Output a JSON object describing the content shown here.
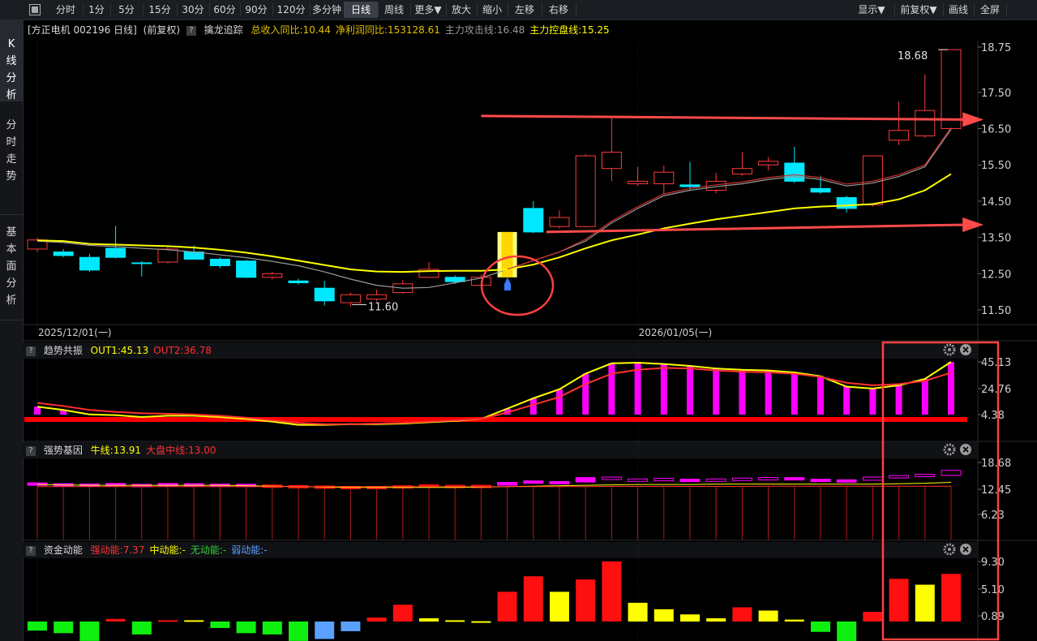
{
  "toolbar": {
    "items": [
      "分时",
      "1分",
      "5分",
      "15分",
      "30分",
      "60分",
      "90分",
      "120分",
      "多分钟",
      "日线",
      "周线",
      "更多▼",
      "放大",
      "缩小",
      "左移",
      "右移"
    ],
    "active_index": 9,
    "right_items": [
      "显示▼",
      "前复权▼",
      "画线",
      "全屏"
    ]
  },
  "sidebar": {
    "items": [
      {
        "label": "K线分析",
        "lines": [
          "K",
          "线",
          "分",
          "析"
        ],
        "active": true
      },
      {
        "label": "分时走势",
        "lines": [
          "分",
          "时",
          "走",
          "势"
        ],
        "active": false
      },
      {
        "label": "基本面分析",
        "lines": [
          "基",
          "本",
          "面",
          "分",
          "析"
        ],
        "active": false
      }
    ]
  },
  "stock": {
    "title": "[方正电机 002196 日线]",
    "adjust": "(前复权)",
    "indicator_name": "擒龙追踪",
    "stats": [
      {
        "text": "总收入同比:10.44",
        "color": "#e0c000"
      },
      {
        "text": "净利润同比:153128.61",
        "color": "#e0c000"
      },
      {
        "text": "主力攻击线:16.48",
        "color": "#9a9a9a"
      },
      {
        "text": "主力控盘线:15.25",
        "color": "#ffff00"
      }
    ]
  },
  "panes": {
    "trend": {
      "name": "趋势共振",
      "values": [
        {
          "text": "OUT1:45.13",
          "color": "#ffff00"
        },
        {
          "text": "OUT2:36.78",
          "color": "#ff3030"
        }
      ]
    },
    "strength": {
      "name": "强势基因",
      "values": [
        {
          "text": "牛线:13.91",
          "color": "#ffff00"
        },
        {
          "text": "大盘中线:13.00",
          "color": "#ff3030"
        }
      ]
    },
    "fund": {
      "name": "资金动能",
      "values": [
        {
          "text": "强动能:7.37",
          "color": "#ff3030"
        },
        {
          "text": "中动能:-",
          "color": "#ffff00"
        },
        {
          "text": "无动能:-",
          "color": "#30d030"
        },
        {
          "text": "弱动能:-",
          "color": "#5aa0ff"
        }
      ]
    }
  },
  "chart_data": [
    {
      "type": "candlestick",
      "title": "[方正电机 002196 日线]",
      "y_ticks": [
        "18.75",
        "17.50",
        "16.50",
        "15.50",
        "14.50",
        "13.50",
        "12.50",
        "11.50"
      ],
      "ylim": [
        11.3,
        19.0
      ],
      "x_labels": [
        "2025/12/01(一)",
        "2026/01/05(一)"
      ],
      "x_label_index": [
        0,
        23
      ],
      "annotations": {
        "high_label": "18.68",
        "low_label": "11.60"
      },
      "candles": [
        {
          "o": 13.18,
          "c": 13.43,
          "h": 13.5,
          "l": 13.1
        },
        {
          "o": 13.1,
          "c": 13.0,
          "h": 13.18,
          "l": 12.96
        },
        {
          "o": 12.95,
          "c": 12.6,
          "h": 13.05,
          "l": 12.55
        },
        {
          "o": 13.2,
          "c": 12.95,
          "h": 13.82,
          "l": 12.92
        },
        {
          "o": 12.8,
          "c": 12.78,
          "h": 12.85,
          "l": 12.42
        },
        {
          "o": 12.82,
          "c": 13.18,
          "h": 13.25,
          "l": 12.78
        },
        {
          "o": 13.1,
          "c": 12.9,
          "h": 13.28,
          "l": 12.88
        },
        {
          "o": 12.9,
          "c": 12.72,
          "h": 12.95,
          "l": 12.65
        },
        {
          "o": 12.85,
          "c": 12.4,
          "h": 12.88,
          "l": 12.38
        },
        {
          "o": 12.4,
          "c": 12.5,
          "h": 12.55,
          "l": 12.34
        },
        {
          "o": 12.3,
          "c": 12.25,
          "h": 12.36,
          "l": 12.2
        },
        {
          "o": 12.1,
          "c": 11.75,
          "h": 12.3,
          "l": 11.62
        },
        {
          "o": 11.7,
          "c": 11.92,
          "h": 11.98,
          "l": 11.6
        },
        {
          "o": 11.8,
          "c": 11.92,
          "h": 12.06,
          "l": 11.74
        },
        {
          "o": 11.98,
          "c": 12.22,
          "h": 12.32,
          "l": 11.95
        },
        {
          "o": 12.4,
          "c": 12.62,
          "h": 12.82,
          "l": 12.38
        },
        {
          "o": 12.4,
          "c": 12.28,
          "h": 12.45,
          "l": 12.22
        },
        {
          "o": 12.18,
          "c": 12.4,
          "h": 12.48,
          "l": 12.12
        },
        {
          "o": 12.4,
          "c": 13.65,
          "h": 13.65,
          "l": 12.4,
          "highlight": true
        },
        {
          "o": 14.3,
          "c": 13.65,
          "h": 14.5,
          "l": 13.62
        },
        {
          "o": 13.8,
          "c": 14.05,
          "h": 14.25,
          "l": 13.75
        },
        {
          "o": 13.8,
          "c": 15.75,
          "h": 15.8,
          "l": 13.78
        },
        {
          "o": 15.4,
          "c": 15.85,
          "h": 16.85,
          "l": 15.05
        },
        {
          "o": 14.98,
          "c": 15.05,
          "h": 15.45,
          "l": 14.92
        },
        {
          "o": 14.98,
          "c": 15.3,
          "h": 15.48,
          "l": 14.68
        },
        {
          "o": 14.95,
          "c": 14.9,
          "h": 15.58,
          "l": 14.82
        },
        {
          "o": 14.8,
          "c": 15.05,
          "h": 15.28,
          "l": 14.72
        },
        {
          "o": 15.25,
          "c": 15.4,
          "h": 15.85,
          "l": 15.2
        },
        {
          "o": 15.5,
          "c": 15.6,
          "h": 15.72,
          "l": 15.35
        },
        {
          "o": 15.55,
          "c": 15.05,
          "h": 16.0,
          "l": 15.0
        },
        {
          "o": 14.85,
          "c": 14.75,
          "h": 15.2,
          "l": 14.7
        },
        {
          "o": 14.6,
          "c": 14.3,
          "h": 14.65,
          "l": 14.18
        },
        {
          "o": 14.4,
          "c": 15.75,
          "h": 15.75,
          "l": 14.35
        },
        {
          "o": 16.18,
          "c": 16.45,
          "h": 17.25,
          "l": 16.05
        },
        {
          "o": 16.3,
          "c": 17.0,
          "h": 18.0,
          "l": 16.25
        },
        {
          "o": 16.5,
          "c": 18.68,
          "h": 18.68,
          "l": 16.48
        }
      ],
      "series": [
        {
          "name": "主力攻击线",
          "color": "#9a9a9a",
          "values": [
            13.4,
            13.36,
            13.28,
            13.25,
            13.2,
            13.16,
            13.1,
            13.02,
            12.94,
            12.84,
            12.72,
            12.55,
            12.35,
            12.18,
            12.1,
            12.12,
            12.25,
            12.38,
            12.62,
            12.86,
            13.1,
            13.4,
            13.9,
            14.3,
            14.65,
            14.8,
            14.9,
            14.98,
            15.1,
            15.18,
            15.1,
            14.92,
            15.0,
            15.18,
            15.45,
            16.48
          ]
        },
        {
          "name": "主力控盘线",
          "color": "#ffff00",
          "values": [
            13.42,
            13.4,
            13.32,
            13.3,
            13.28,
            13.26,
            13.22,
            13.16,
            13.08,
            12.98,
            12.86,
            12.74,
            12.62,
            12.56,
            12.55,
            12.57,
            12.58,
            12.58,
            12.62,
            12.75,
            12.95,
            13.2,
            13.42,
            13.58,
            13.75,
            13.88,
            14.0,
            14.1,
            14.2,
            14.3,
            14.35,
            14.38,
            14.42,
            14.55,
            14.8,
            15.25
          ]
        }
      ],
      "arrows": [
        {
          "from": {
            "x": 17.0,
            "y": 16.85
          },
          "to": {
            "x": 36.0,
            "y": 16.75
          }
        },
        {
          "from": {
            "x": 19.5,
            "y": 13.65
          },
          "to": {
            "x": 36.0,
            "y": 13.85
          }
        }
      ]
    },
    {
      "type": "bar",
      "title": "趋势共振",
      "y_ticks": [
        "45.13",
        "24.76",
        "4.38"
      ],
      "ylim": [
        -5,
        55
      ],
      "baseline": 4.38,
      "series": [
        {
          "name": "OUT1",
          "color": "#ffff00",
          "values": [
            10.5,
            8.0,
            4.5,
            4.0,
            2.5,
            3.5,
            3.5,
            2.5,
            1.0,
            -1.0,
            -3.5,
            -3.5,
            -3.0,
            -3.0,
            -2.5,
            -1.5,
            -0.5,
            1.0,
            9.0,
            17.0,
            24.0,
            36.0,
            44.0,
            44.5,
            43.5,
            42.0,
            40.0,
            39.0,
            38.5,
            37.0,
            34.0,
            26.0,
            24.5,
            27.0,
            32.0,
            45.13
          ]
        },
        {
          "name": "OUT2",
          "color": "#ff3030",
          "values": [
            13.5,
            11.0,
            8.0,
            6.5,
            5.5,
            5.0,
            4.5,
            3.5,
            2.0,
            0.0,
            -2.0,
            -3.0,
            -3.0,
            -2.5,
            -2.0,
            -1.0,
            0.0,
            1.0,
            6.0,
            12.0,
            18.0,
            28.0,
            36.0,
            39.0,
            40.5,
            40.0,
            38.5,
            37.5,
            37.0,
            36.0,
            33.5,
            29.0,
            27.0,
            28.0,
            30.5,
            36.78
          ]
        },
        {
          "name": "bars",
          "color": "#ff00ff",
          "values": [
            10.5,
            8.0,
            0,
            0,
            0,
            0,
            0,
            0,
            0,
            0,
            0,
            0,
            0,
            0,
            0,
            0,
            0,
            0,
            9.0,
            17.0,
            24.0,
            36.0,
            44.0,
            44.5,
            43.5,
            42.0,
            40.0,
            39.0,
            38.5,
            37.0,
            34.0,
            26.0,
            24.5,
            27.0,
            32.0,
            45.13
          ]
        }
      ]
    },
    {
      "type": "bar",
      "title": "强势基因",
      "y_ticks": [
        "18.68",
        "12.45",
        "6.23"
      ],
      "ylim": [
        0,
        21
      ],
      "series": [
        {
          "name": "牛线",
          "color": "#ffff00",
          "values": [
            13.4,
            13.3,
            13.2,
            13.2,
            13.2,
            13.2,
            13.2,
            13.2,
            13.1,
            13.0,
            12.9,
            12.8,
            12.7,
            12.7,
            12.7,
            12.7,
            12.7,
            12.8,
            12.9,
            13.0,
            13.1,
            13.2,
            13.3,
            13.4,
            13.4,
            13.4,
            13.5,
            13.5,
            13.5,
            13.5,
            13.5,
            13.5,
            13.5,
            13.6,
            13.7,
            13.91
          ]
        },
        {
          "name": "大盘中线",
          "color": "#ff3030",
          "values": [
            12.9,
            12.9,
            12.9,
            12.9,
            12.9,
            12.9,
            12.9,
            12.9,
            12.9,
            12.9,
            12.9,
            12.9,
            12.9,
            12.9,
            12.9,
            12.9,
            12.9,
            12.9,
            12.9,
            12.9,
            12.9,
            12.9,
            12.95,
            12.95,
            12.95,
            12.95,
            12.95,
            12.95,
            13.0,
            13.0,
            13.0,
            13.0,
            13.0,
            13.0,
            13.0,
            13.0
          ]
        }
      ]
    },
    {
      "type": "bar",
      "title": "资金动能",
      "y_ticks": [
        "9.30",
        "5.10",
        "0.89"
      ],
      "ylim": [
        -3,
        10
      ],
      "values": [
        -1.4,
        -1.8,
        -3.0,
        0.4,
        -2.0,
        0.2,
        0.2,
        -1.0,
        -1.8,
        -2.0,
        -3.0,
        -2.7,
        -1.5,
        0.6,
        2.6,
        0.5,
        0.2,
        0.05,
        4.6,
        7.0,
        4.6,
        6.5,
        9.3,
        2.9,
        1.9,
        1.1,
        0.5,
        2.2,
        1.7,
        0.3,
        -1.6,
        -3.4,
        1.5,
        6.6,
        5.7,
        7.37
      ],
      "colors": [
        "green",
        "green",
        "green",
        "red",
        "green",
        "red",
        "yellow",
        "green",
        "green",
        "green",
        "green",
        "blue",
        "blue",
        "red",
        "red",
        "yellow",
        "yellow",
        "yellow",
        "red",
        "red",
        "yellow",
        "red",
        "red",
        "yellow",
        "yellow",
        "yellow",
        "yellow",
        "red",
        "yellow",
        "yellow",
        "green",
        "green",
        "red",
        "red",
        "yellow",
        "red"
      ],
      "color_map": {
        "red": "#ff1010",
        "yellow": "#ffff00",
        "green": "#10f010",
        "blue": "#5aa0ff"
      }
    }
  ]
}
